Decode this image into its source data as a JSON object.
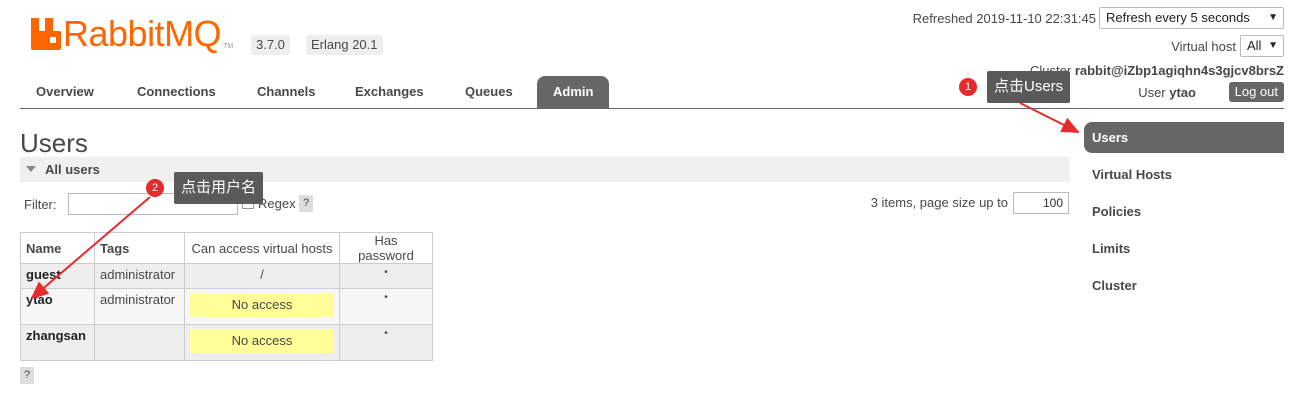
{
  "header": {
    "logo_text": "RabbitMQ",
    "logo_tm": "TM",
    "version": "3.7.0",
    "erlang": "Erlang 20.1",
    "refreshed": "Refreshed 2019-11-10 22:31:45",
    "refresh_select": "Refresh every 5 seconds",
    "virtual_host_label": "Virtual host",
    "virtual_host_select": "All",
    "cluster_label": "Cluster",
    "cluster_name": "rabbit@iZbp1agiqhn4s3gjcv8brsZ",
    "user_label": "User",
    "user_name": "ytao",
    "logout_label": "Log out"
  },
  "tabs": [
    {
      "label": "Overview",
      "active": false
    },
    {
      "label": "Connections",
      "active": false
    },
    {
      "label": "Channels",
      "active": false
    },
    {
      "label": "Exchanges",
      "active": false
    },
    {
      "label": "Queues",
      "active": false
    },
    {
      "label": "Admin",
      "active": true
    }
  ],
  "main": {
    "title": "Users",
    "section_title": "All users",
    "filter_label": "Filter:",
    "filter_value": "",
    "regex_label": "Regex",
    "help_label": "?",
    "items_label": "3 items, page size up to",
    "page_size": "100",
    "table": {
      "columns": [
        "Name",
        "Tags",
        "Can access virtual hosts",
        "Has password"
      ],
      "rows": [
        {
          "name": "guest",
          "tags": "administrator",
          "vhosts": "/",
          "has_password": "•"
        },
        {
          "name": "ytao",
          "tags": "administrator",
          "vhosts": "No access",
          "has_password": "•"
        },
        {
          "name": "zhangsan",
          "tags": "",
          "vhosts": "No access",
          "has_password": "•"
        }
      ]
    },
    "bottom_help": "?"
  },
  "right_nav": [
    {
      "label": "Users",
      "active": true
    },
    {
      "label": "Virtual Hosts",
      "active": false
    },
    {
      "label": "Policies",
      "active": false
    },
    {
      "label": "Limits",
      "active": false
    },
    {
      "label": "Cluster",
      "active": false
    }
  ],
  "annotations": {
    "step1_number": "1",
    "step1_text": "点击Users",
    "step2_number": "2",
    "step2_text": "点击用户名"
  },
  "colors": {
    "brand": "#ff6600",
    "nav_active": "#666666",
    "no_access": "#ffff99",
    "annotation_red": "#e52b2b"
  }
}
